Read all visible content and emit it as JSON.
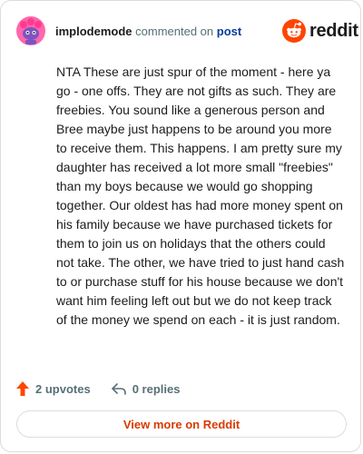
{
  "header": {
    "username": "implodemode",
    "action_text": "commented on",
    "target_text": "post",
    "logo_text": "reddit"
  },
  "icons": {
    "avatar": "snoo-avatar-icon",
    "logo": "reddit-logo-icon",
    "upvote": "upvote-arrow-icon",
    "reply": "reply-arrow-icon"
  },
  "comment": {
    "body": "NTA These are just spur of the moment - here ya go - one offs. They are not gifts as such. They are freebies. You sound like a generous person and Bree maybe just happens to be around you more to receive them. This happens. I am pretty sure my daughter has received a lot more small \"freebies\" than my boys because we would go shopping together. Our oldest has had more money spent on his family because we have purchased tickets for them to join us on holidays that the others could not take. The other, we have tried to just hand cash to or purchase stuff for his house because we don't want him feeling left out but we do not keep track of the money we spend on each - it is just random."
  },
  "stats": {
    "upvotes_label": "2 upvotes",
    "replies_label": "0 replies"
  },
  "footer": {
    "view_more_label": "View more on Reddit"
  },
  "colors": {
    "brand": "#ff4500",
    "accent_text": "#d93a00",
    "link": "#0a3d9c",
    "muted": "#576f76",
    "avatar_bg": "#ff66ac",
    "avatar_face": "#7e53c1"
  }
}
